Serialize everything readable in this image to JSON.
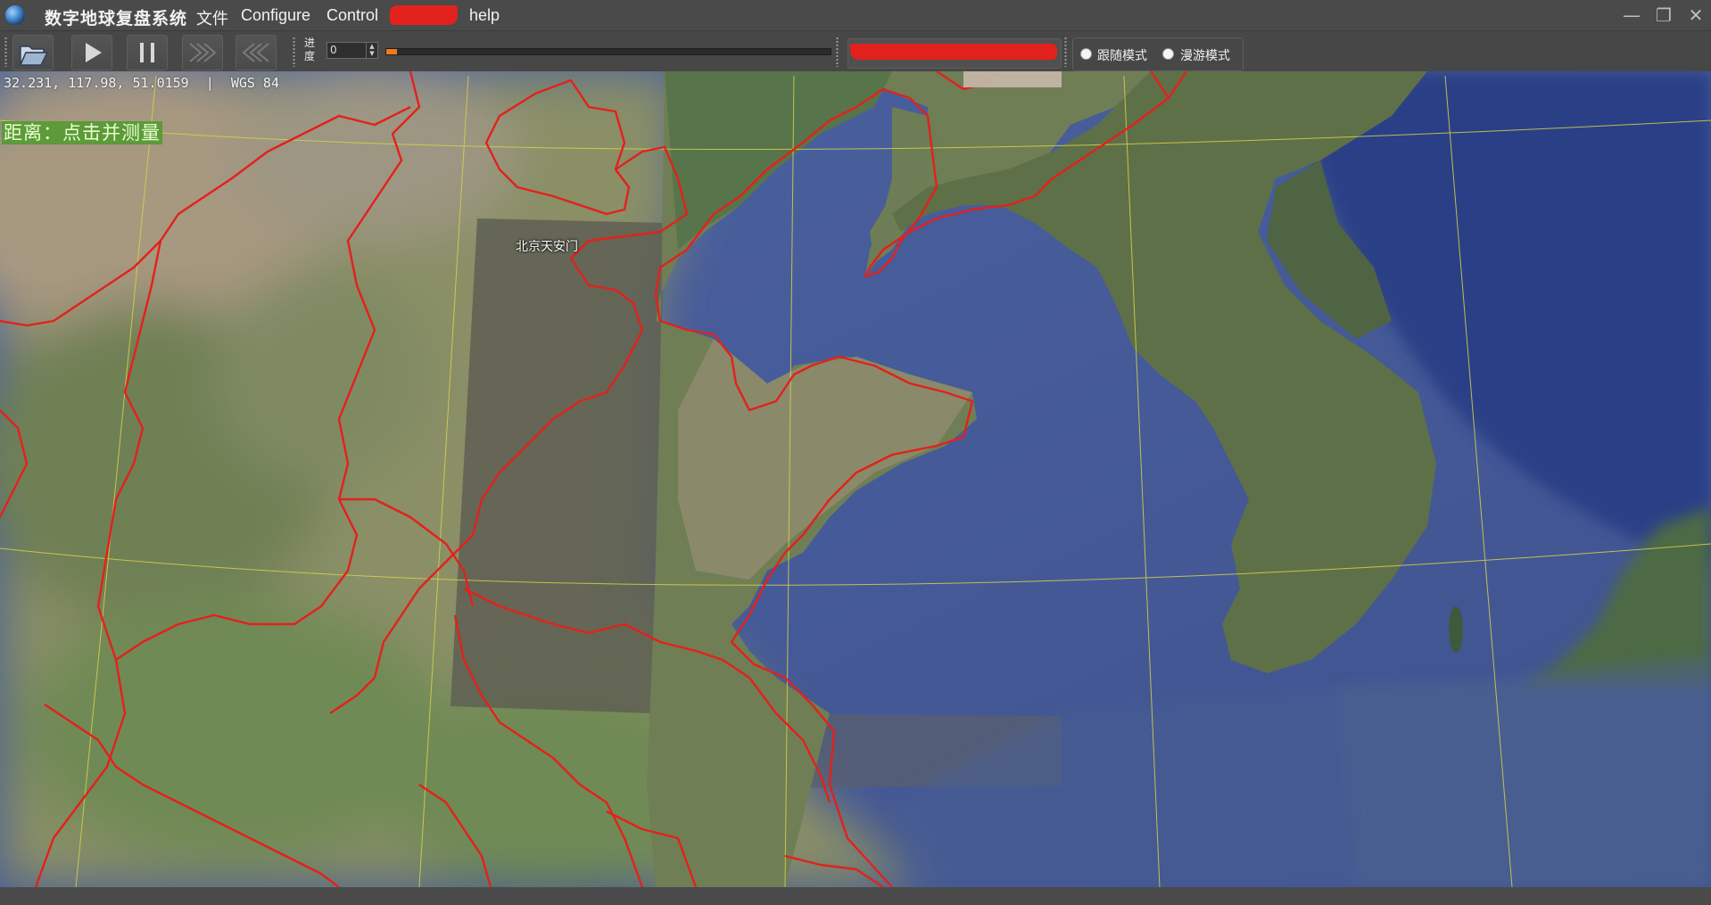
{
  "app": {
    "title": "数字地球复盘系统"
  },
  "menu": {
    "items": [
      "文件",
      "Configure",
      "Control",
      "help"
    ]
  },
  "window_controls": {
    "minimize": "—",
    "restore": "❐",
    "close": "✕"
  },
  "toolbar": {
    "buttons": [
      {
        "name": "open",
        "icon": "folder-open-icon"
      },
      {
        "name": "play",
        "icon": "play-icon"
      },
      {
        "name": "pause",
        "icon": "pause-icon"
      },
      {
        "name": "fast-forward",
        "icon": "fast-forward-icon"
      },
      {
        "name": "rewind",
        "icon": "rewind-icon"
      }
    ],
    "progress_label": "进度",
    "progress_value": "0",
    "progress_fraction": 0.025,
    "modes": [
      {
        "label": "跟随模式",
        "selected": false
      },
      {
        "label": "漫游模式",
        "selected": false
      }
    ]
  },
  "map": {
    "coordinates": "32.231, 117.98, 51.0159",
    "separator": "|",
    "datum": "WGS 84",
    "measure_text": "距离：点击并测量",
    "place_label": "北京天安门"
  },
  "colors": {
    "boundary": "#e3211c",
    "graticule": "#d6d24a",
    "sea": "#4a5f94",
    "accent_progress": "#f07a1a"
  }
}
